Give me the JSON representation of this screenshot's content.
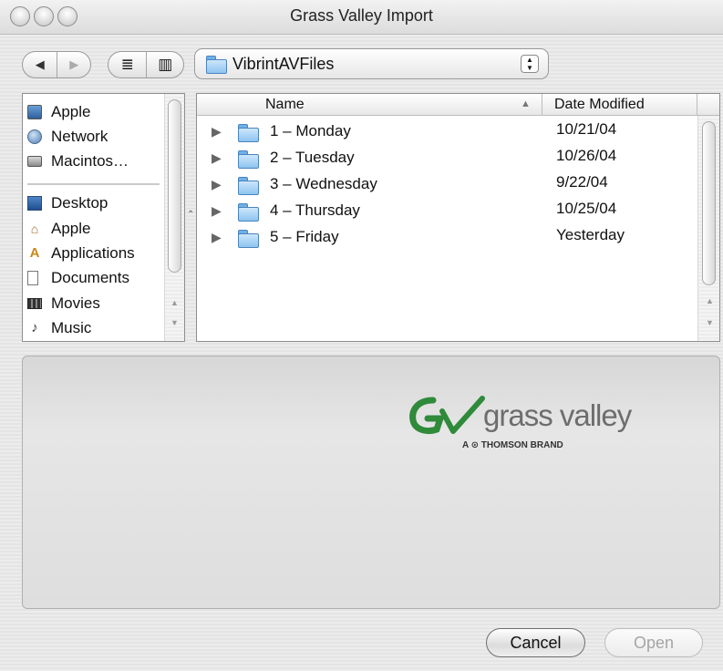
{
  "window": {
    "title": "Grass Valley Import"
  },
  "toolbar": {
    "back_glyph": "◀",
    "forward_glyph": "▶",
    "view_list_glyph": "≣",
    "view_column_glyph": "▥",
    "location": "VibrintAVFiles"
  },
  "sidebar": {
    "items": [
      {
        "label": "Apple",
        "icon": "imac-icon"
      },
      {
        "label": "Network",
        "icon": "globe-icon"
      },
      {
        "label": "Macintos…",
        "icon": "hard-drive-icon"
      },
      {
        "label": "Desktop",
        "icon": "desktop-icon"
      },
      {
        "label": "Apple",
        "icon": "home-icon"
      },
      {
        "label": "Applications",
        "icon": "applications-icon"
      },
      {
        "label": "Documents",
        "icon": "document-icon"
      },
      {
        "label": "Movies",
        "icon": "film-icon"
      },
      {
        "label": "Music",
        "icon": "music-note-icon"
      }
    ]
  },
  "browser": {
    "columns": {
      "name": "Name",
      "date": "Date Modified"
    },
    "rows": [
      {
        "name": "1 – Monday",
        "date": "10/21/04"
      },
      {
        "name": "2 – Tuesday",
        "date": "10/26/04"
      },
      {
        "name": "3 – Wednesday",
        "date": "9/22/04"
      },
      {
        "name": "4 – Thursday",
        "date": "10/25/04"
      },
      {
        "name": "5 – Friday",
        "date": "Yesterday"
      }
    ]
  },
  "preview": {
    "logo_text": "grass valley",
    "logo_sub": "A ⊙ THOMSON BRAND"
  },
  "buttons": {
    "cancel": "Cancel",
    "open": "Open"
  },
  "colors": {
    "folder": "#8ec4f0",
    "logo_green": "#2f8a3a",
    "logo_gray": "#6d6d6d"
  }
}
